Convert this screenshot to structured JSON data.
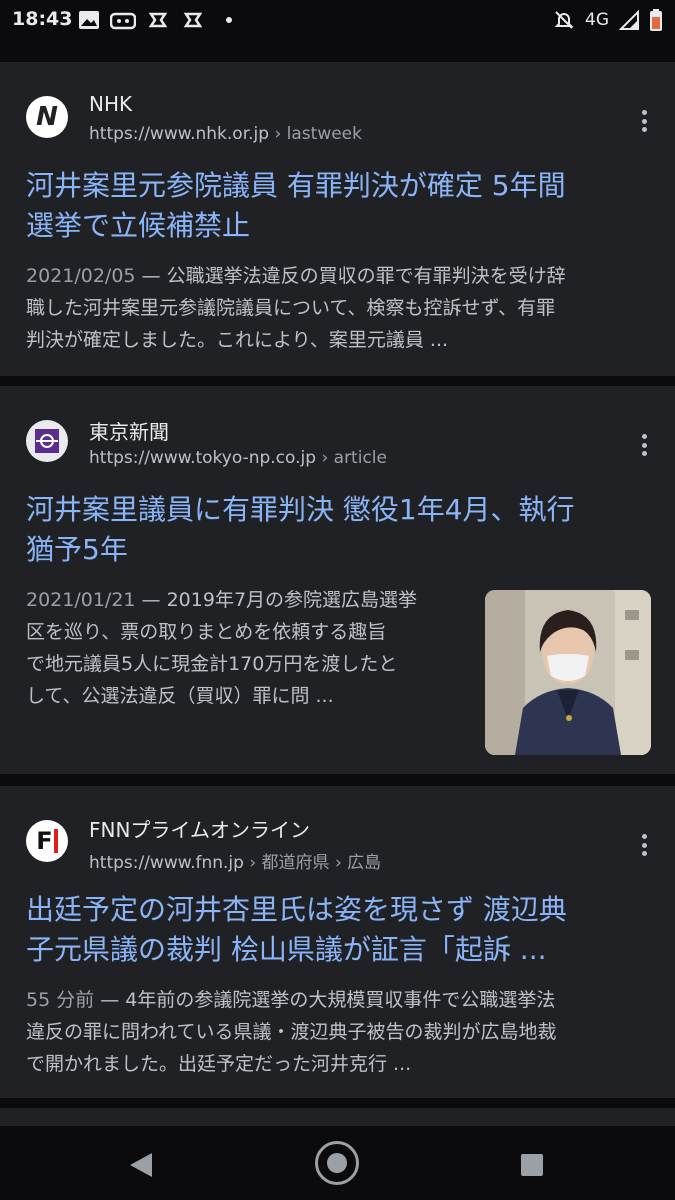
{
  "status_bar": {
    "time": "18:43",
    "network": "4G",
    "icons": [
      "image-icon",
      "game-icon",
      "notification-icon",
      "notification-icon",
      "dot-icon",
      "mute-alarm-icon",
      "signal-icon",
      "battery-icon"
    ]
  },
  "results": [
    {
      "site_name": "NHK",
      "favicon_letter": "N",
      "url": "https://www.nhk.or.jp",
      "breadcrumb": "› lastweek",
      "title_lines": [
        "河井案里元参院議員 有罪判決が確定 5年間",
        "選挙で立候補禁止"
      ],
      "date": "2021/02/05",
      "snippet_first": " — 公職選挙法違反の買収の罪で有罪判決を受け辞",
      "snippet_lines": [
        "職した河井案里元参議院議員について、検察も控訴せず、有罪",
        "判決が確定しました。これにより、案里元議員 ..."
      ]
    },
    {
      "site_name": "東京新聞",
      "url": "https://www.tokyo-np.co.jp",
      "breadcrumb": "› article",
      "title_lines": [
        "河井案里議員に有罪判決 懲役1年4月、執行",
        "猶予5年"
      ],
      "date": "2021/01/21",
      "snippet_first": " — 2019年7月の参院選広島選挙",
      "snippet_lines": [
        "区を巡り、票の取りまとめを依頼する趣旨",
        "で地元議員5人に現金計170万円を渡したと",
        "して、公選法違反（買収）罪に問 ..."
      ]
    },
    {
      "site_name": "FNNプライムオンライン",
      "favicon_letter": "F",
      "url": "https://www.fnn.jp",
      "breadcrumb": "› 都道府県 › 広島",
      "title_lines": [
        "出廷予定の河井杏里氏は姿を現さず 渡辺典",
        "子元県議の裁判 桧山県議が証言「起訴 ..."
      ],
      "date": "55 分前",
      "snippet_first": " — 4年前の参議院選挙の大規模買収事件で公職選挙法",
      "snippet_lines": [
        "違反の罪に問われている県議・渡辺典子被告の裁判が広島地裁",
        "で開かれました。出廷予定だった河井克行 ..."
      ]
    }
  ],
  "colors": {
    "background": "#121316",
    "card": "#202124",
    "link": "#8ab4f8",
    "text": "#bdc1c6"
  }
}
